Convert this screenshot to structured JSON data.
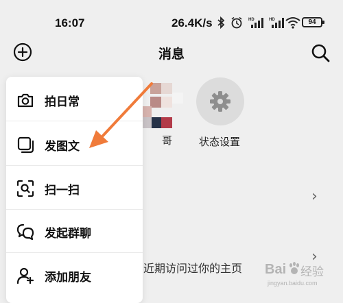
{
  "status_bar": {
    "time": "16:07",
    "speed": "26.4K/s",
    "battery": "94",
    "icons": [
      "bluetooth-icon",
      "alarm-icon",
      "signal-hd-icon",
      "signal-hd-icon",
      "wifi-icon",
      "battery-icon"
    ]
  },
  "header": {
    "title": "消息",
    "left_icon": "add-circle-icon",
    "right_icon": "search-icon"
  },
  "background": {
    "partial_contact_label": "哥",
    "status_setting_label": "状态设置",
    "visit_text": "近期访问过你的主页"
  },
  "menu": {
    "items": [
      {
        "label": "拍日常",
        "icon": "camera-icon"
      },
      {
        "label": "发图文",
        "icon": "image-text-icon"
      },
      {
        "label": "扫一扫",
        "icon": "scan-icon"
      },
      {
        "label": "发起群聊",
        "icon": "group-chat-icon"
      },
      {
        "label": "添加朋友",
        "icon": "add-friend-icon"
      }
    ]
  },
  "annotation": {
    "arrow_color": "#f07b3a"
  },
  "watermark": {
    "brand": "Bai",
    "sub": "经验",
    "url": "jingyan.baidu.com"
  },
  "colors": {
    "background": "#efefef",
    "menu_bg": "#ffffff",
    "arrow": "#f07b3a",
    "accent_yellow": "#f6e400"
  }
}
